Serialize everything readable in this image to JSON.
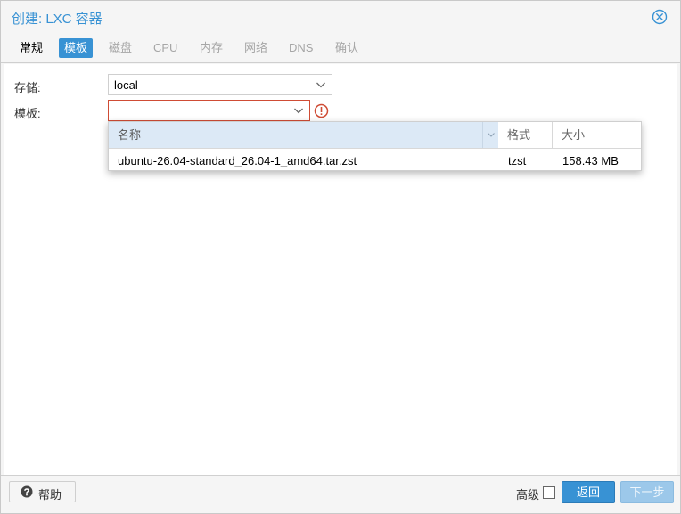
{
  "window": {
    "title": "创建: LXC 容器"
  },
  "tabs": [
    {
      "label": "常规",
      "state": "enabled"
    },
    {
      "label": "模板",
      "state": "active"
    },
    {
      "label": "磁盘",
      "state": "disabled"
    },
    {
      "label": "CPU",
      "state": "disabled"
    },
    {
      "label": "内存",
      "state": "disabled"
    },
    {
      "label": "网络",
      "state": "disabled"
    },
    {
      "label": "DNS",
      "state": "disabled"
    },
    {
      "label": "确认",
      "state": "disabled"
    }
  ],
  "form": {
    "storage_label": "存储:",
    "storage_value": "local",
    "template_label": "模板:",
    "template_value": ""
  },
  "picker": {
    "columns": {
      "name": "名称",
      "format": "格式",
      "size": "大小"
    },
    "rows": [
      {
        "name": "ubuntu-26.04-standard_26.04-1_amd64.tar.zst",
        "format": "tzst",
        "size": "158.43 MB"
      }
    ]
  },
  "footer": {
    "help_label": "帮助",
    "advanced_label": "高级",
    "back_label": "返回",
    "next_label": "下一步"
  },
  "colors": {
    "accent": "#3892d4",
    "error": "#cf4c35",
    "disabled_button": "#9cc8ea"
  }
}
